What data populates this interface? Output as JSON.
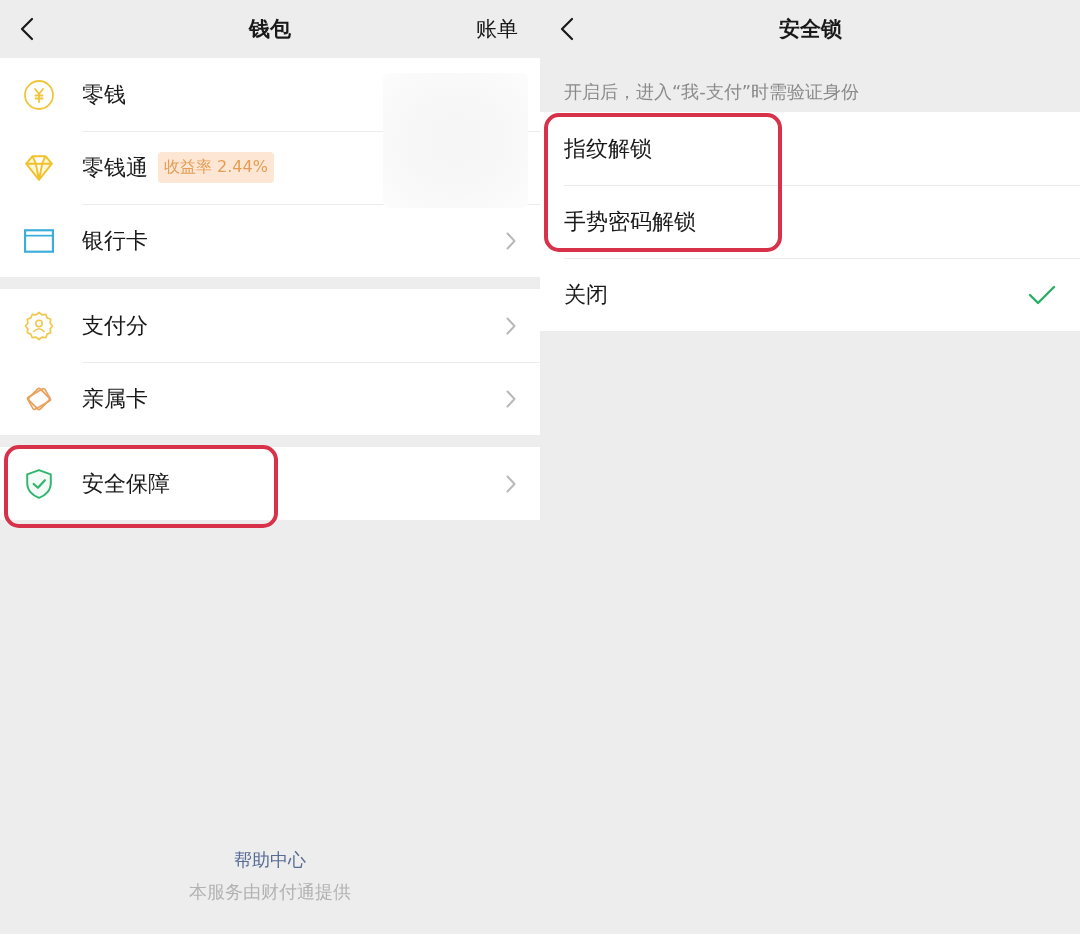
{
  "wallet": {
    "title": "钱包",
    "action": "账单",
    "groups": [
      {
        "blurred": true,
        "items": [
          {
            "label": "零钱",
            "chevron": false,
            "highlighted": false
          },
          {
            "label": "零钱通",
            "badge": "收益率 2.44%",
            "chevron": false,
            "highlighted": false
          },
          {
            "label": "银行卡",
            "chevron": true,
            "highlighted": false
          }
        ]
      },
      {
        "blurred": false,
        "items": [
          {
            "label": "支付分",
            "chevron": true,
            "highlighted": false
          },
          {
            "label": "亲属卡",
            "chevron": true,
            "highlighted": false
          }
        ]
      },
      {
        "blurred": false,
        "items": [
          {
            "label": "安全保障",
            "chevron": true,
            "highlighted": true
          }
        ]
      }
    ],
    "help_link": "帮助中心",
    "provider_note": "本服务由财付通提供"
  },
  "security_lock": {
    "title": "安全锁",
    "description": "开启后，进入“我-支付”时需验证身份",
    "options": [
      {
        "label": "指纹解锁",
        "selected": false,
        "highlighted": true
      },
      {
        "label": "手势密码解锁",
        "selected": false,
        "highlighted": true
      },
      {
        "label": "关闭",
        "selected": true,
        "highlighted": false
      }
    ]
  }
}
